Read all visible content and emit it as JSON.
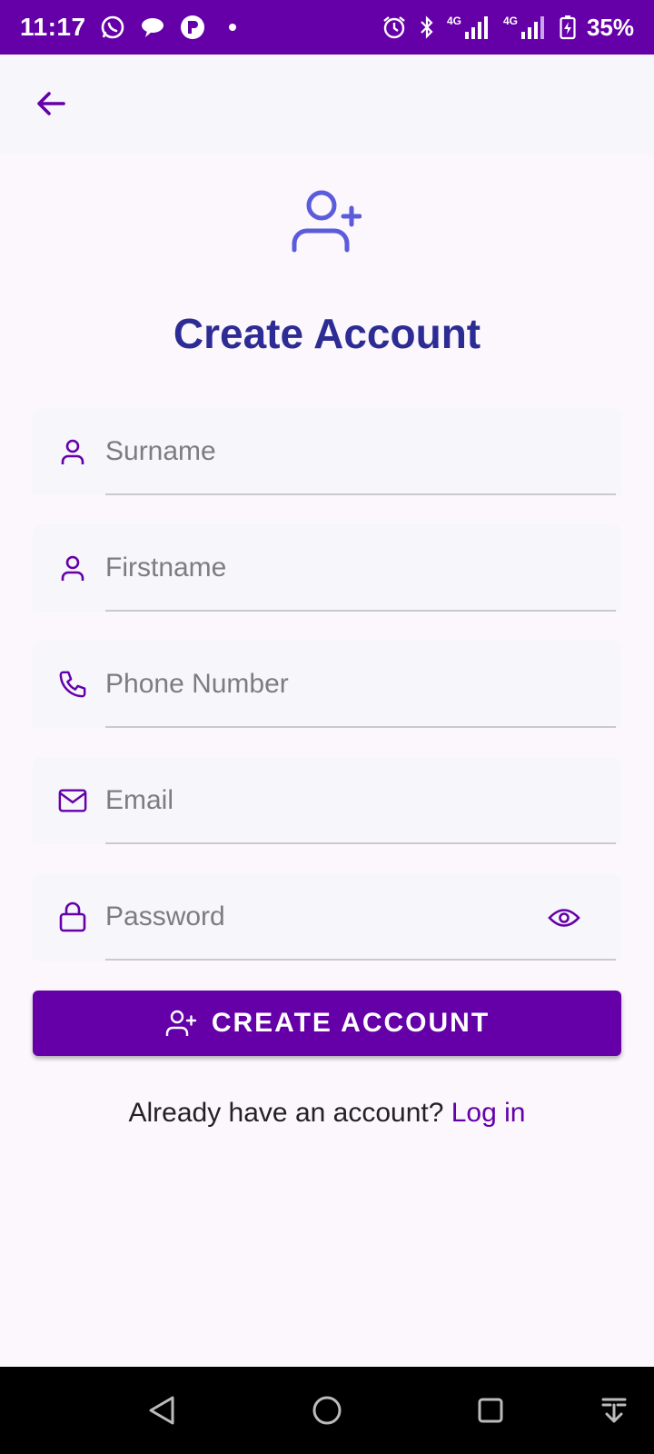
{
  "status_bar": {
    "time": "11:17",
    "battery": "35%",
    "network_1": "4G",
    "network_2": "4G",
    "background_color": "#6500a8",
    "left_icons": [
      "whatsapp-icon",
      "chat-bubble-icon",
      "app-notification-icon",
      "dot-icon"
    ],
    "right_icons": [
      "alarm-icon",
      "bluetooth-icon",
      "signal-icon",
      "signal-icon",
      "battery-charging-icon"
    ]
  },
  "app_bar": {
    "back_icon": "arrow-left-icon"
  },
  "header": {
    "icon": "user-plus-icon",
    "title": "Create Account"
  },
  "form": {
    "surname": {
      "placeholder": "Surname",
      "value": "",
      "icon": "user-icon"
    },
    "firstname": {
      "placeholder": "Firstname",
      "value": "",
      "icon": "user-icon"
    },
    "phone": {
      "placeholder": "Phone Number",
      "value": "",
      "icon": "phone-icon"
    },
    "email": {
      "placeholder": "Email",
      "value": "",
      "icon": "mail-icon"
    },
    "password": {
      "placeholder": "Password",
      "value": "",
      "icon": "lock-icon",
      "toggle_icon": "eye-icon"
    }
  },
  "create_button": {
    "label": "CREATE ACCOUNT",
    "icon": "user-plus-icon"
  },
  "login_prompt": {
    "text": "Already have an account?",
    "link": "Log in"
  },
  "colors": {
    "primary": "#6500a8",
    "title": "#2c2c94",
    "hero_icon": "#5b5bdc",
    "background": "#fcf7fc",
    "field_background": "#f6f6fb"
  }
}
